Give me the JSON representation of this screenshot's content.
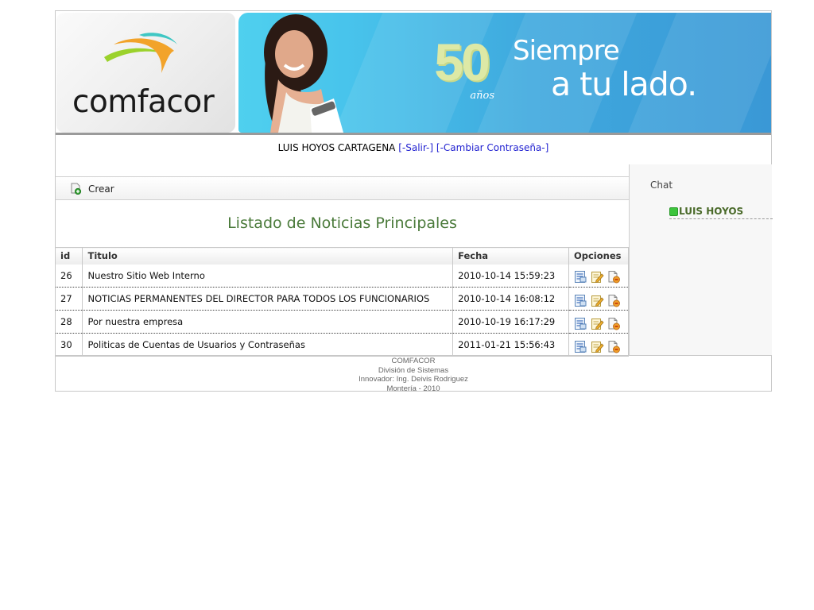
{
  "header": {
    "logo_text": "comfacor",
    "badge_number": "50",
    "badge_sub": "años",
    "slogan_line1": "Siempre",
    "slogan_line2": "a tu lado."
  },
  "userbar": {
    "user_name": "LUIS HOYOS CARTAGENA",
    "logout_label": "[-Salir-]",
    "change_password_label": "[-Cambiar Contraseña-]"
  },
  "toolbar": {
    "create_label": "Crear"
  },
  "main": {
    "title": "Listado de Noticias Principales"
  },
  "table": {
    "columns": [
      "id",
      "Titulo",
      "Fecha",
      "Opciones"
    ],
    "rows": [
      {
        "id": "26",
        "title": "Nuestro Sitio Web Interno",
        "date": "2010-10-14 15:59:23"
      },
      {
        "id": "27",
        "title": "NOTICIAS PERMANENTES DEL DIRECTOR PARA TODOS LOS FUNCIONARIOS",
        "date": "2010-10-14 16:08:12"
      },
      {
        "id": "28",
        "title": "Por nuestra empresa",
        "date": "2010-10-19 16:17:29"
      },
      {
        "id": "30",
        "title": "Politicas de Cuentas de Usuarios y Contraseñas",
        "date": "2011-01-21 15:56:43"
      }
    ],
    "option_icons": [
      "view-icon",
      "edit-icon",
      "delete-icon"
    ]
  },
  "chat": {
    "title": "Chat",
    "user": "LUIS HOYOS",
    "status_color": "#3cc43c"
  },
  "footer": {
    "line1": "COMFACOR",
    "line2": "División de Sistemas",
    "line3": "Innovador: Ing. Deivis Rodriguez",
    "line4": "Montería - 2010"
  },
  "colors": {
    "title_green": "#4a7a3a",
    "link_blue": "#1f1fd0",
    "banner_blue": "#3fa9de"
  }
}
